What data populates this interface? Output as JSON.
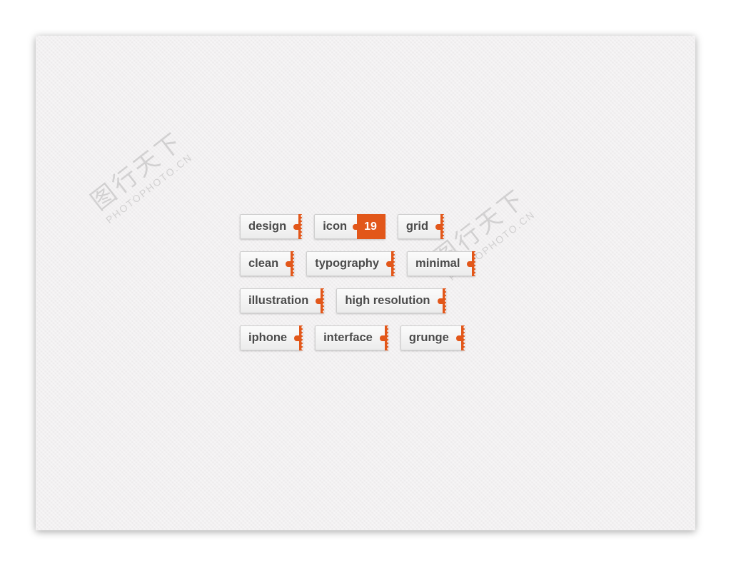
{
  "watermark": {
    "logo_text": "图行天下",
    "site": "PHOTOPHOTO.CN"
  },
  "tags": [
    [
      {
        "label": "design"
      },
      {
        "label": "icon",
        "count": "19"
      },
      {
        "label": "grid"
      }
    ],
    [
      {
        "label": "clean"
      },
      {
        "label": "typography"
      },
      {
        "label": "minimal"
      }
    ],
    [
      {
        "label": "illustration"
      },
      {
        "label": "high resolution"
      }
    ],
    [
      {
        "label": "iphone"
      },
      {
        "label": "interface"
      },
      {
        "label": "grunge"
      }
    ]
  ],
  "colors": {
    "accent": "#e2571a",
    "background": "#f2f0f1",
    "text": "#4a4a4a"
  }
}
